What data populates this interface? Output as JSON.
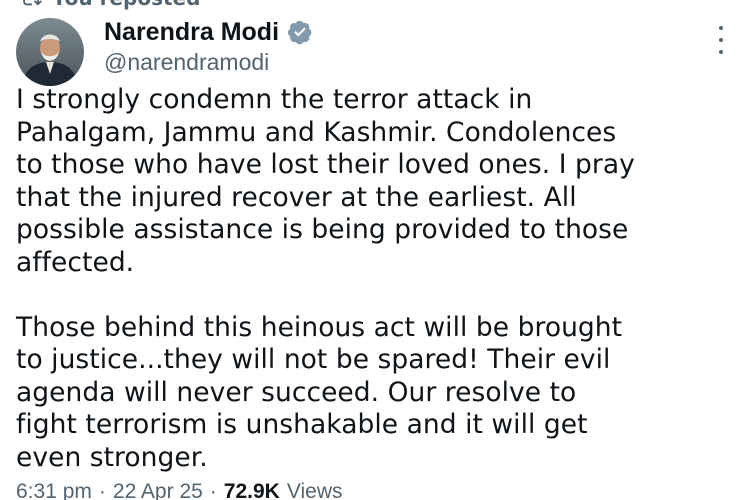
{
  "repost": {
    "label": "You reposted"
  },
  "author": {
    "name": "Narendra Modi",
    "handle": "@narendramodi"
  },
  "tweet": {
    "paragraph_1": [
      "I strongly condemn the terror attack in",
      "Pahalgam, Jammu and Kashmir. Condolences",
      "to those who have lost their loved ones. I pray",
      "that the injured recover at the earliest. All",
      "possible assistance is being provided to those",
      "affected."
    ],
    "paragraph_2": [
      "Those behind this heinous act will be brought",
      "to justice...they will not be spared! Their evil",
      "agenda will never succeed. Our resolve to",
      "fight terrorism is unshakable and it will get",
      "even stronger."
    ]
  },
  "meta": {
    "time": "6:31 pm",
    "separator": "·",
    "date": "22 Apr 25",
    "views_count": "72.9K",
    "views_label": "Views"
  },
  "colors": {
    "text": "#0f1419",
    "secondary": "#536471",
    "verified": "#829aab"
  },
  "icons": {
    "repost": "repost-icon",
    "verified": "verified-badge-icon",
    "more": "more-options-icon"
  }
}
